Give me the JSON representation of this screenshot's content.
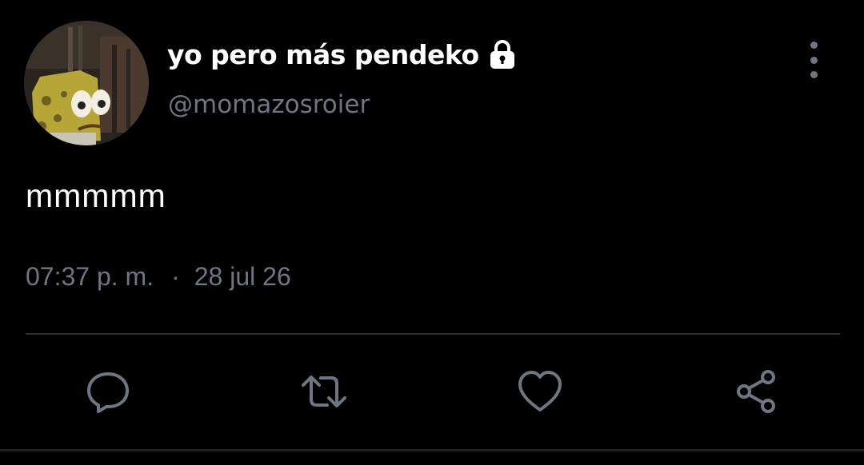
{
  "tweet": {
    "display_name": "yo pero más pendeko",
    "handle": "@momazosroier",
    "text": "mmmmm",
    "time": "07:37 p. m.",
    "separator": "·",
    "date": "28 jul 26"
  },
  "icons": {
    "lock": "lock-icon",
    "more": "more-vertical-icon",
    "reply": "reply-icon",
    "retweet": "retweet-icon",
    "like": "heart-icon",
    "share": "share-icon"
  },
  "colors": {
    "background": "#000000",
    "text": "#ffffff",
    "muted": "#6e7681",
    "divider": "#2f3336"
  }
}
